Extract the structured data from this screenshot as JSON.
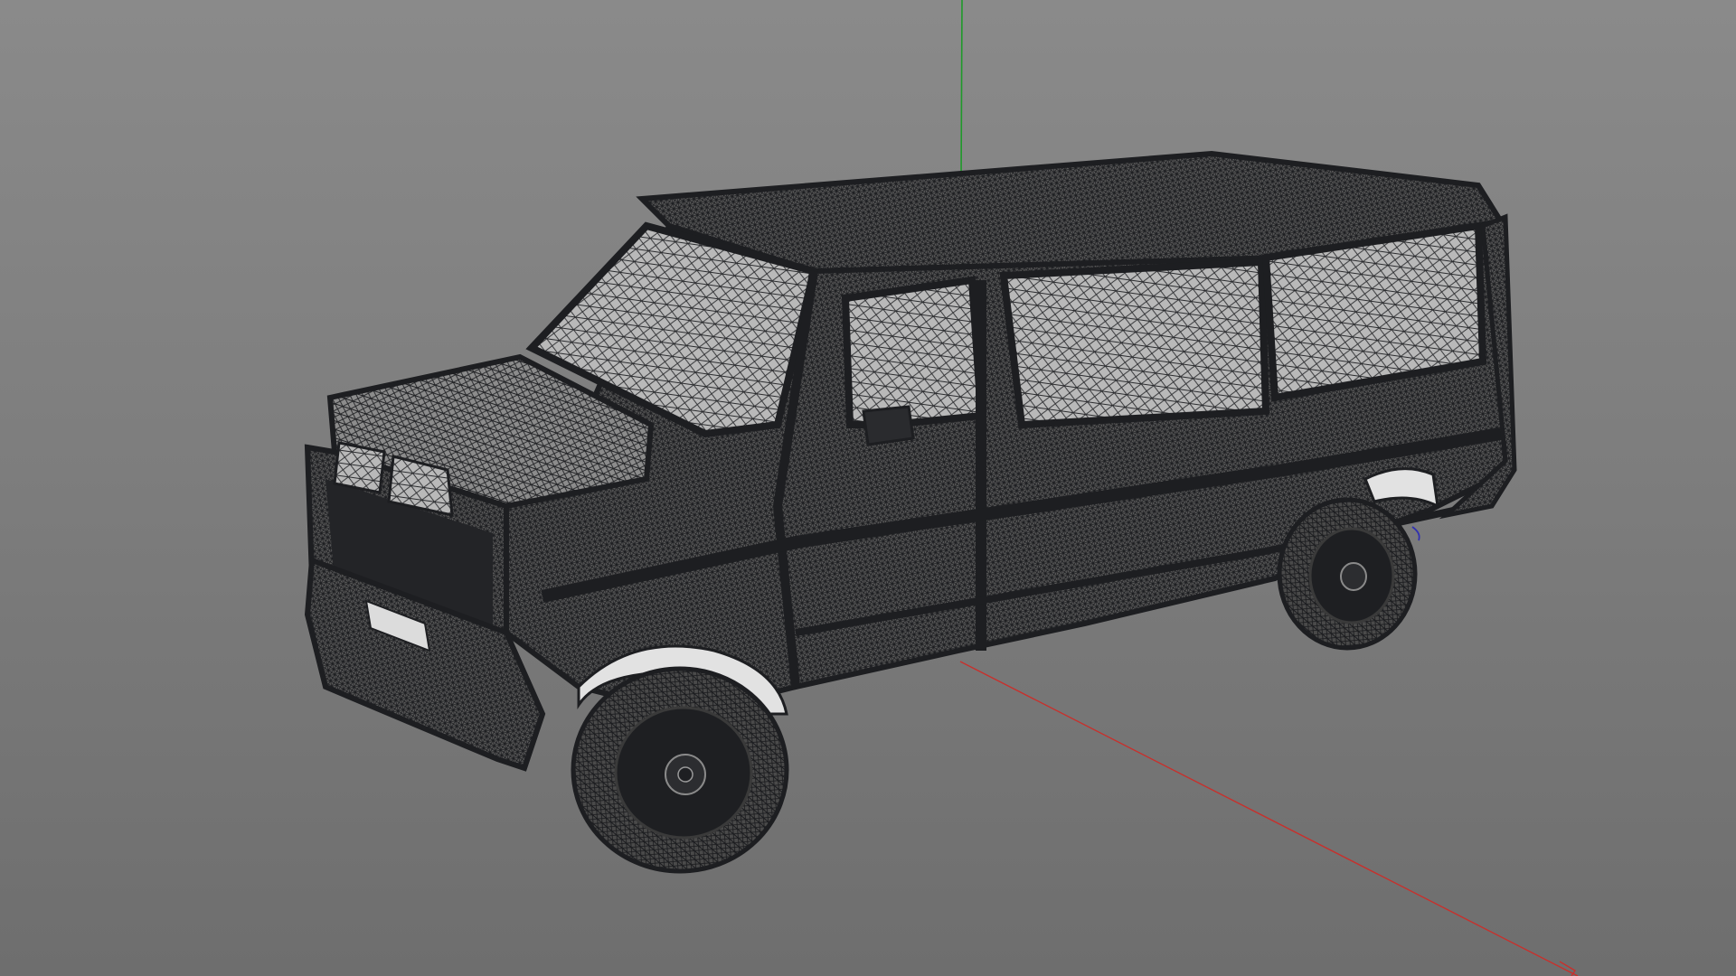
{
  "viewport": {
    "background_top": "#8a8a8a",
    "background_bottom": "#6e6e6e",
    "render_mode": "wireframe",
    "model": "van",
    "mesh_color": "#2a2b2e",
    "mesh_highlight": "#d8d8d8",
    "axes": {
      "x_color": "#c8302c",
      "y_color": "#1f9a2a",
      "z_color": "#3030b0"
    }
  }
}
